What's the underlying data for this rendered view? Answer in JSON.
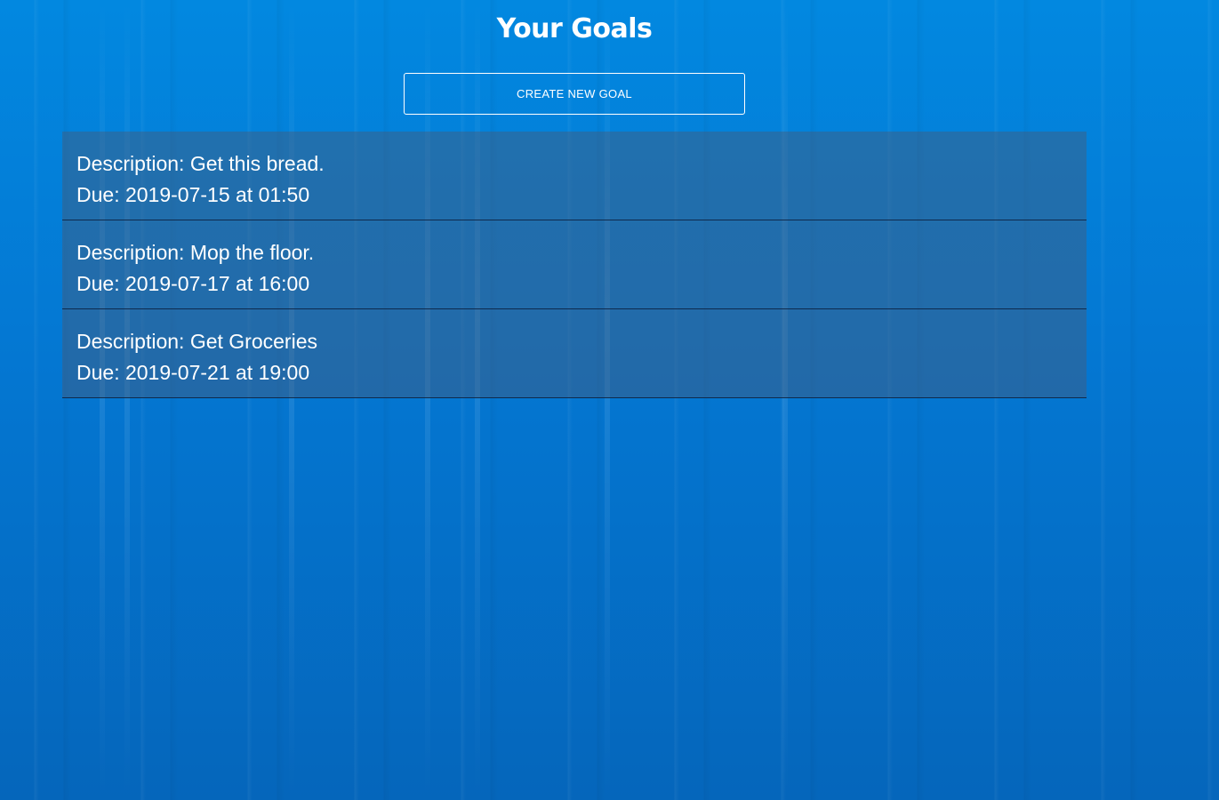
{
  "page": {
    "title": "Your Goals"
  },
  "actions": {
    "create_label": "CREATE NEW GOAL"
  },
  "goals": [
    {
      "description": "Description: Get this bread.",
      "due": "Due: 2019-07-15 at 01:50"
    },
    {
      "description": "Description: Mop the floor.",
      "due": "Due: 2019-07-17 at 16:00"
    },
    {
      "description": "Description: Get Groceries",
      "due": "Due: 2019-07-21 at 19:00"
    }
  ],
  "colors": {
    "background_top": "#0288e0",
    "background_bottom": "#0566bb",
    "text": "#ffffff"
  }
}
